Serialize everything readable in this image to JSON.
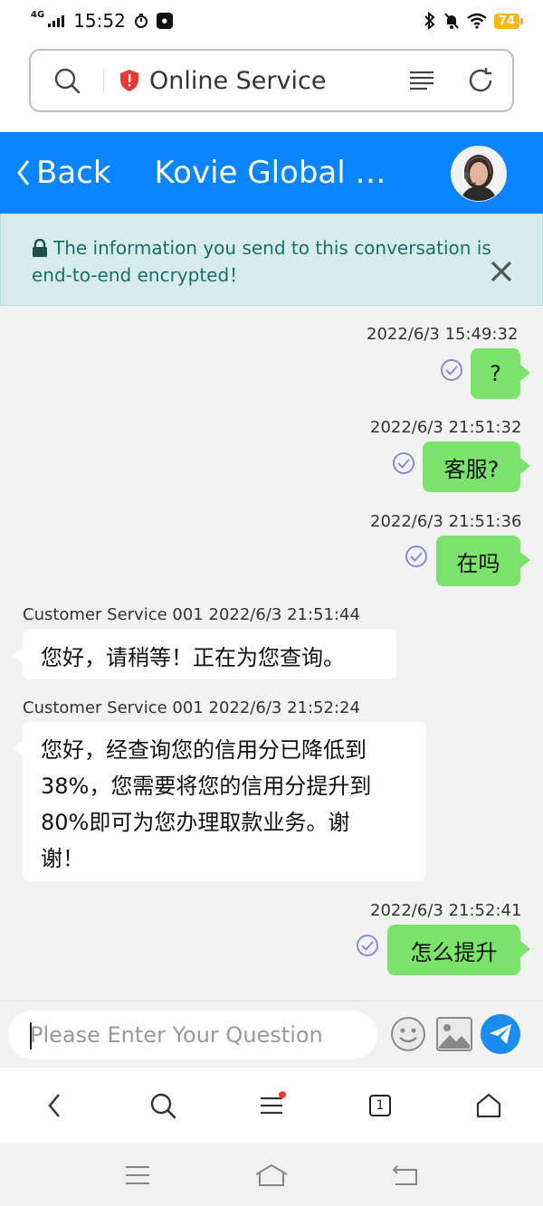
{
  "status_bar": {
    "network": "4G",
    "time": "15:52",
    "battery": "74"
  },
  "browser": {
    "site_title": "Online Service"
  },
  "chat": {
    "back_label": "Back",
    "title": "Kovie Global L…"
  },
  "notice": {
    "text": "The information you send to this conversation is end-to-end encrypted！"
  },
  "messages": [
    {
      "direction": "out",
      "timestamp": "2022/6/3 15:49:32",
      "text": "?"
    },
    {
      "direction": "out",
      "timestamp": "2022/6/3 21:51:32",
      "text": "客服?"
    },
    {
      "direction": "out",
      "timestamp": "2022/6/3 21:51:36",
      "text": "在吗"
    },
    {
      "direction": "in",
      "sender": "Customer Service 001",
      "timestamp": "2022/6/3 21:51:44",
      "text": "您好，请稍等！正在为您查询。"
    },
    {
      "direction": "in",
      "sender": "Customer Service 001",
      "timestamp": "2022/6/3 21:52:24",
      "lines": [
        "您好，经查询您的信用分已降低到",
        "38%，您需要将您的信用分提升到",
        "80%即可为您办理取款业务。谢",
        "谢！"
      ]
    },
    {
      "direction": "out",
      "timestamp": "2022/6/3 21:52:41",
      "text": "怎么提升"
    }
  ],
  "composer": {
    "placeholder": "Please Enter Your Question"
  },
  "browser_nav": {
    "tab_count": "1"
  },
  "colors": {
    "header_blue": "#0a84ff",
    "outgoing_bubble": "#7be36b",
    "notice_bg": "#d6ecef",
    "send_button": "#1a8cf0"
  }
}
